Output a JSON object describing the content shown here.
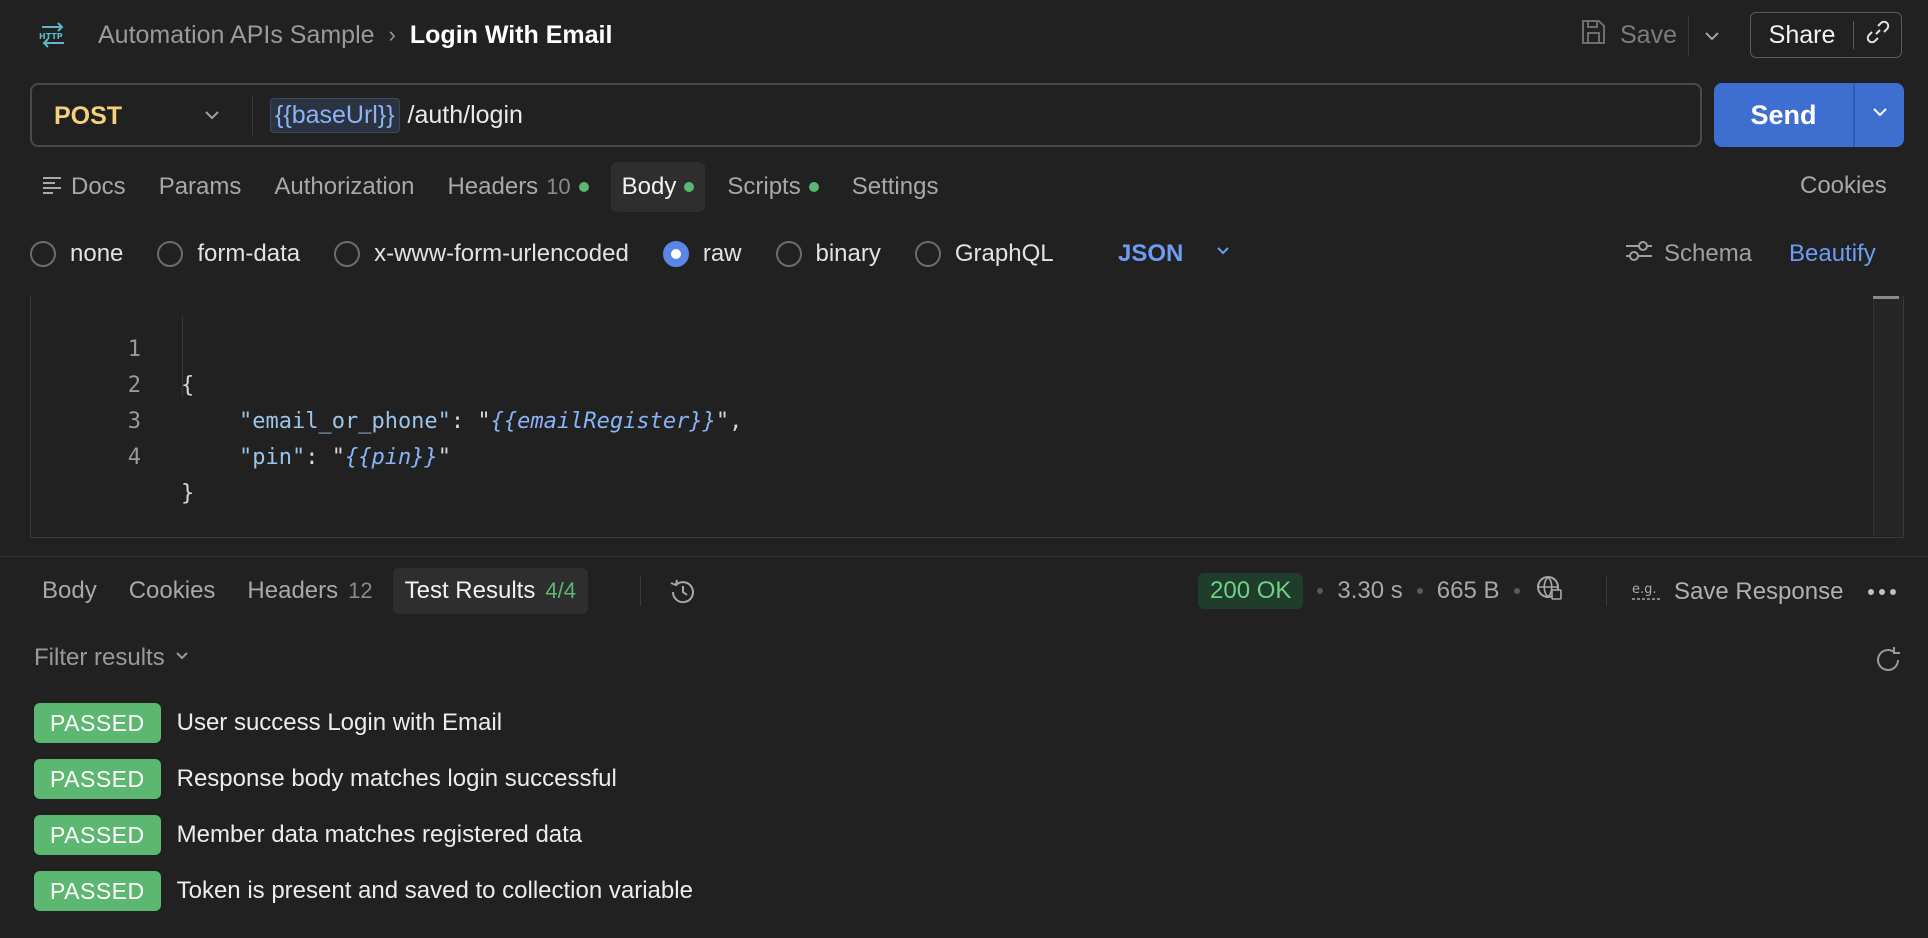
{
  "header": {
    "collection": "Automation APIs Sample",
    "request_name": "Login With Email",
    "save_label": "Save",
    "share_label": "Share"
  },
  "request": {
    "method": "POST",
    "url_variable": "{{baseUrl}}",
    "url_path": "/auth/login",
    "send_label": "Send"
  },
  "request_tabs": [
    {
      "label": "Docs"
    },
    {
      "label": "Params"
    },
    {
      "label": "Authorization"
    },
    {
      "label": "Headers",
      "count": "10",
      "dot": true
    },
    {
      "label": "Body",
      "dot": true,
      "active": true
    },
    {
      "label": "Scripts",
      "dot": true
    },
    {
      "label": "Settings"
    }
  ],
  "cookies_label": "Cookies",
  "body_types": [
    {
      "label": "none",
      "checked": false
    },
    {
      "label": "form-data",
      "checked": false
    },
    {
      "label": "x-www-form-urlencoded",
      "checked": false
    },
    {
      "label": "raw",
      "checked": true
    },
    {
      "label": "binary",
      "checked": false
    },
    {
      "label": "GraphQL",
      "checked": false
    }
  ],
  "body_format": "JSON",
  "schema_label": "Schema",
  "beautify_label": "Beautify",
  "editor": {
    "line_numbers": [
      "1",
      "2",
      "3",
      "4"
    ],
    "open_brace": "{",
    "close_brace": "}",
    "line2_key": "\"email_or_phone\"",
    "line2_value": "{{emailRegister}}",
    "line3_key": "\"pin\"",
    "line3_value": "{{pin}}"
  },
  "response_tabs": [
    {
      "label": "Body"
    },
    {
      "label": "Cookies"
    },
    {
      "label": "Headers",
      "count": "12"
    },
    {
      "label": "Test Results",
      "count": "4/4",
      "active": true
    }
  ],
  "response_meta": {
    "status": "200 OK",
    "time": "3.30 s",
    "size": "665 B",
    "save_response_label": "Save Response"
  },
  "filter_label": "Filter results",
  "test_results": [
    {
      "status": "PASSED",
      "name": "User success Login with Email"
    },
    {
      "status": "PASSED",
      "name": "Response body matches login successful"
    },
    {
      "status": "PASSED",
      "name": "Member data matches registered data"
    },
    {
      "status": "PASSED",
      "name": "Token is present and saved to collection variable"
    }
  ],
  "colors": {
    "background": "#212121",
    "accent_blue": "#3e6fd0",
    "method_post": "#f5d27a",
    "passed_green": "#5cb870"
  }
}
